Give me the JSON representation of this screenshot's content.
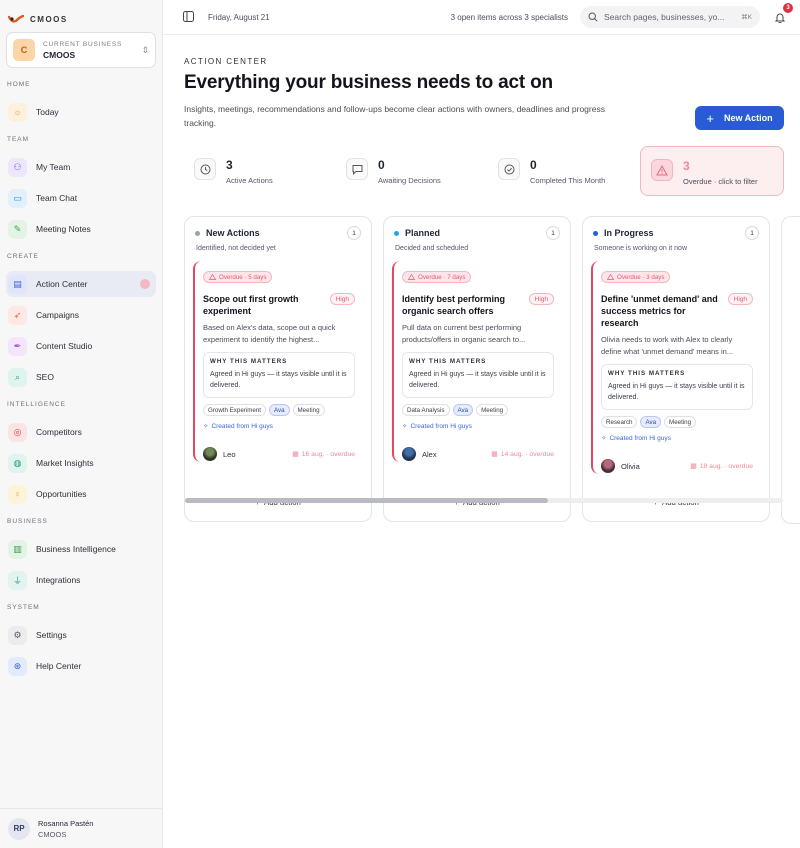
{
  "app": {
    "name": "CMOOS"
  },
  "business": {
    "label": "CURRENT BUSINESS",
    "name": "CMOOS",
    "initial": "C"
  },
  "sidebar": {
    "sections": [
      {
        "label": "HOME",
        "items": [
          {
            "label": "Today",
            "icon": "sun-icon"
          }
        ]
      },
      {
        "label": "TEAM",
        "items": [
          {
            "label": "My Team",
            "icon": "users-icon"
          },
          {
            "label": "Team Chat",
            "icon": "chat-icon"
          },
          {
            "label": "Meeting Notes",
            "icon": "notes-icon"
          }
        ]
      },
      {
        "label": "CREATE",
        "items": [
          {
            "label": "Action Center",
            "icon": "action-center-icon",
            "active": true
          },
          {
            "label": "Campaigns",
            "icon": "rocket-icon"
          },
          {
            "label": "Content Studio",
            "icon": "pen-icon"
          },
          {
            "label": "SEO",
            "icon": "search-icon"
          }
        ]
      },
      {
        "label": "INTELLIGENCE",
        "items": [
          {
            "label": "Competitors",
            "icon": "target-icon"
          },
          {
            "label": "Market Insights",
            "icon": "globe-icon"
          },
          {
            "label": "Opportunities",
            "icon": "lightbulb-icon"
          }
        ]
      },
      {
        "label": "BUSINESS",
        "items": [
          {
            "label": "Business Intelligence",
            "icon": "bar-chart-icon"
          },
          {
            "label": "Integrations",
            "icon": "plug-icon"
          }
        ]
      },
      {
        "label": "SYSTEM",
        "items": [
          {
            "label": "Settings",
            "icon": "gear-icon"
          },
          {
            "label": "Help Center",
            "icon": "lifebuoy-icon"
          }
        ]
      }
    ]
  },
  "user": {
    "initials": "RP",
    "name": "Rosanna Pastén",
    "org": "CMOOS"
  },
  "topbar": {
    "date": "Friday, August 21",
    "open_items": "3 open items across 3 specialists",
    "search_placeholder": "Search pages, businesses, yo...",
    "search_shortcut": "⌘K",
    "notification_count": "3"
  },
  "page": {
    "eyebrow": "ACTION CENTER",
    "title": "Everything your business needs to act on",
    "description": "Insights, meetings, recommendations and follow-ups become clear actions with owners, deadlines and progress tracking.",
    "new_action_label": "New Action"
  },
  "stats": [
    {
      "value": "3",
      "label": "Active Actions",
      "icon": "clock-icon"
    },
    {
      "value": "0",
      "label": "Awaiting Decisions",
      "icon": "message-icon"
    },
    {
      "value": "0",
      "label": "Completed This Month",
      "icon": "check-circle-icon"
    },
    {
      "value": "3",
      "label": "Overdue · click to filter",
      "icon": "warning-icon"
    }
  ],
  "colors": {
    "accent": "#2a5bd7",
    "overdue": "#e34a62",
    "new_dot": "#9aa0ac",
    "planned_dot": "#22a7e0",
    "progress_dot": "#2a5bd7"
  },
  "columns": [
    {
      "title": "New Actions",
      "count": "1",
      "subtitle": "Identified, not decided yet",
      "card": {
        "overdue": "Overdue · 5 days",
        "title": "Scope out first growth experiment",
        "priority": "High",
        "description": "Based on Alex's data, scope out a quick experiment to identify the highest...",
        "why_label": "WHY THIS MATTERS",
        "why_text": "Agreed in Hi guys — it stays visible until it is delivered.",
        "tags": [
          "Growth Experiment",
          "Ava",
          "Meeting"
        ],
        "created": "Created from Hi guys",
        "assignee": "Leo",
        "due": "16 aug. · overdue"
      },
      "add_label": "Add action"
    },
    {
      "title": "Planned",
      "count": "1",
      "subtitle": "Decided and scheduled",
      "card": {
        "overdue": "Overdue · 7 days",
        "title": "Identify best performing organic search offers",
        "priority": "High",
        "description": "Pull data on current best performing products/offers in organic search to...",
        "why_label": "WHY THIS MATTERS",
        "why_text": "Agreed in Hi guys — it stays visible until it is delivered.",
        "tags": [
          "Data Analysis",
          "Ava",
          "Meeting"
        ],
        "created": "Created from Hi guys",
        "assignee": "Alex",
        "due": "14 aug. · overdue"
      },
      "add_label": "Add action"
    },
    {
      "title": "In Progress",
      "count": "1",
      "subtitle": "Someone is working on it now",
      "card": {
        "overdue": "Overdue · 3 days",
        "title": "Define 'unmet demand' and success metrics for research",
        "priority": "High",
        "description": "Olivia needs to work with Alex to clearly define what 'unmet demand' means in...",
        "why_label": "WHY THIS MATTERS",
        "why_text": "Agreed in Hi guys — it stays visible until it is delivered.",
        "tags": [
          "Research",
          "Ava",
          "Meeting"
        ],
        "created": "Created from Hi guys",
        "assignee": "Olivia",
        "due": "18 aug. · overdue"
      },
      "add_label": "Add action"
    }
  ]
}
